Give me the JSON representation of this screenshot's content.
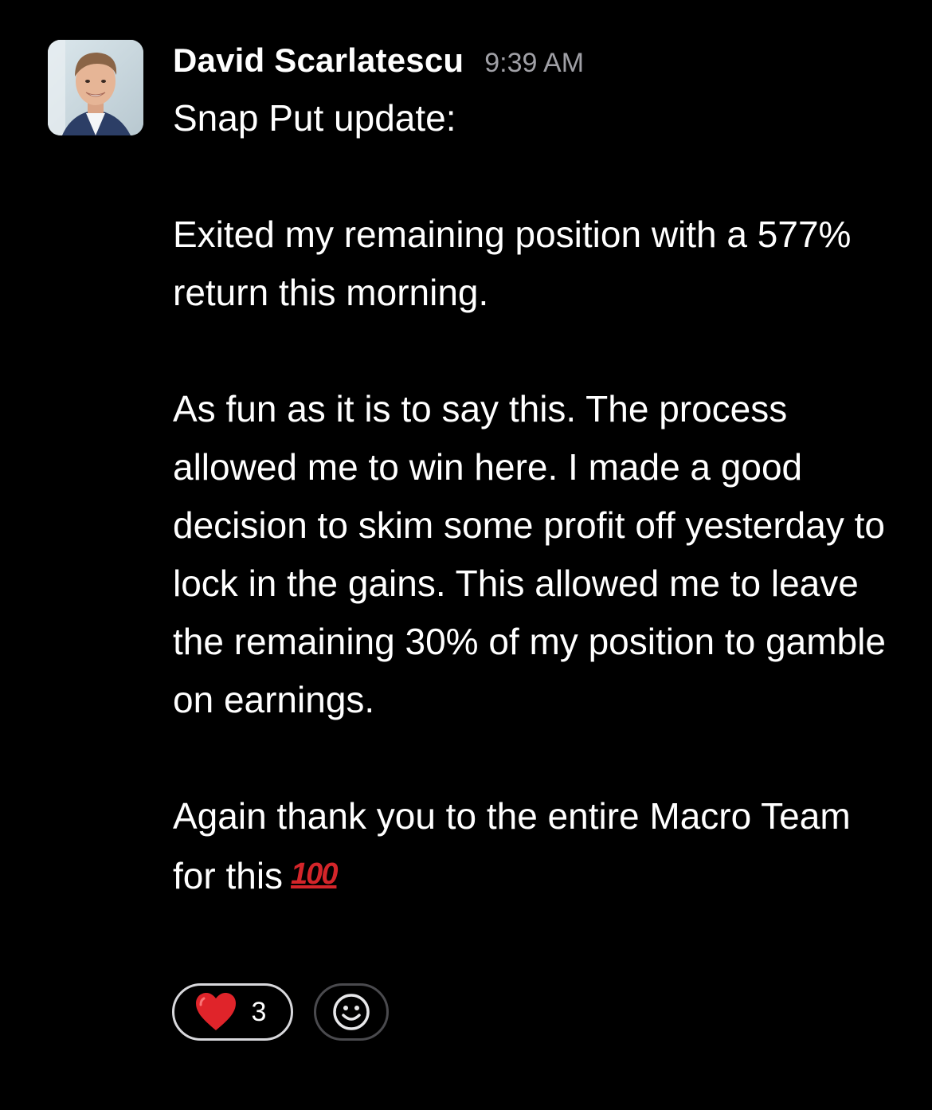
{
  "message": {
    "author": "David Scarlatescu",
    "timestamp": "9:39 AM",
    "paragraphs": [
      "Snap Put update:",
      "Exited my remaining position with a 577% return this morning.",
      "As fun as it is to say this. The process allowed me to win here. I made a good decision to skim some profit off yesterday to lock in the gains. This allowed me to leave the remaining 30% of my position to gamble on earnings.",
      "Again thank you to the entire Macro Team for this"
    ],
    "trailing_emoji": "💯",
    "trailing_emoji_icon": "hundred-points-icon"
  },
  "reactions": [
    {
      "icon": "red-heart-icon",
      "count": "3"
    }
  ],
  "add_reaction_icon": "smiley-face-icon",
  "colors": {
    "background": "#000000",
    "text": "#ffffff",
    "timestamp": "#a0a0a6",
    "accent_red": "#e0242a"
  }
}
